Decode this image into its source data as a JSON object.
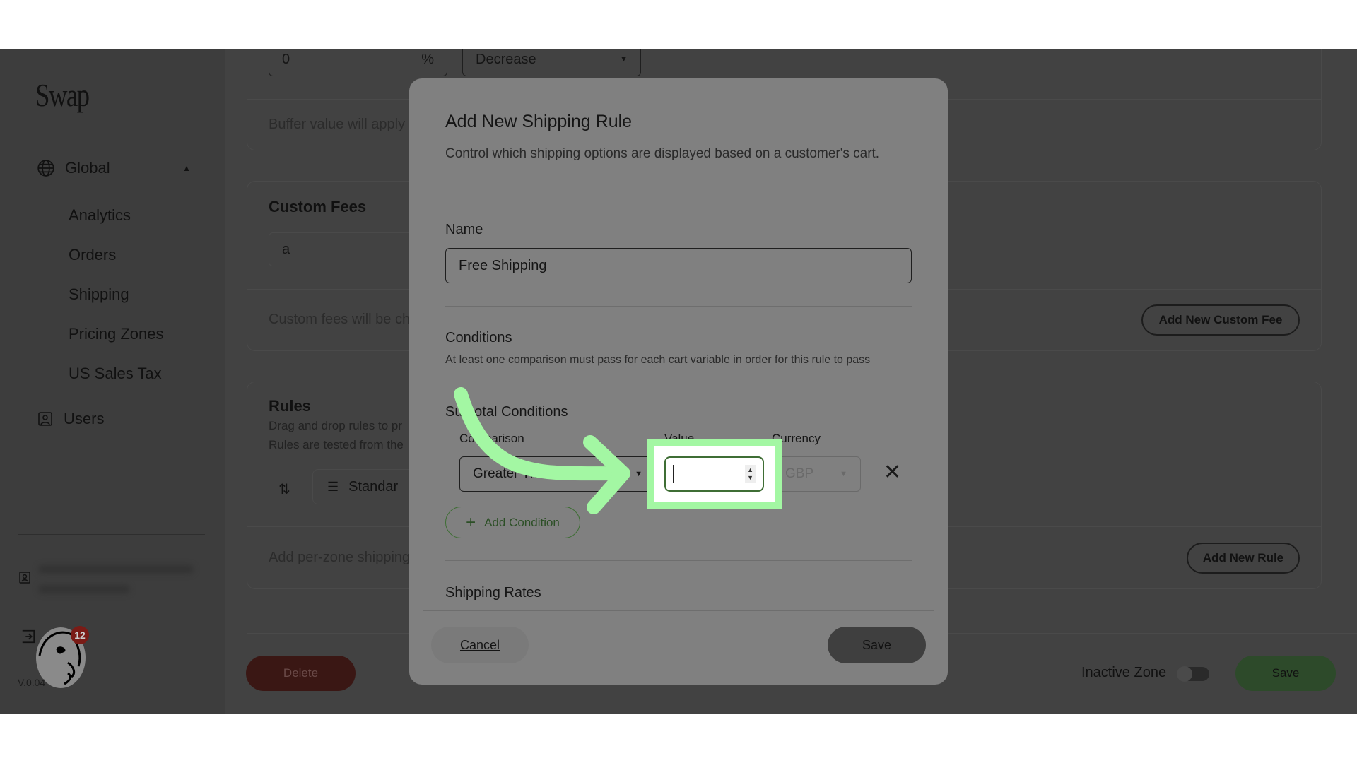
{
  "sidebar": {
    "logo": "Swap",
    "global": "Global",
    "items": [
      "Analytics",
      "Orders",
      "Shipping",
      "Pricing Zones",
      "US Sales Tax"
    ],
    "users": "Users",
    "badge": "12",
    "version": "V.0.04"
  },
  "main": {
    "buffer_value": "0",
    "buffer_unit": "%",
    "buffer_direction": "Decrease",
    "buffer_note": "Buffer value will apply",
    "custom_fees_title": "Custom Fees",
    "custom_fee_value": "a",
    "custom_fees_note": "Custom fees will be ch",
    "add_custom_fee": "Add New Custom Fee",
    "rules_title": "Rules",
    "rules_desc1": "Drag and drop rules to pr",
    "rules_desc2": "Rules are tested from the",
    "rule_item": "Standar",
    "rules_note": "Add per-zone shipping",
    "add_rule": "Add New Rule",
    "delete": "Delete",
    "inactive_zone": "Inactive Zone",
    "save": "Save"
  },
  "modal": {
    "title": "Add New Shipping Rule",
    "description": "Control which shipping options are displayed based on a customer's cart.",
    "name_label": "Name",
    "name_value": "Free Shipping",
    "conditions_title": "Conditions",
    "conditions_desc": "At least one comparison must pass for each cart variable in order for this rule to pass",
    "subtotal_title": "Subtotal Conditions",
    "col_comparison": "Comparison",
    "col_value": "Value",
    "col_currency": "Currency",
    "comparison_value": "Greater Than",
    "value_input": "",
    "currency_value": "GBP",
    "add_condition": "Add Condition",
    "shipping_rates": "Shipping Rates",
    "cancel": "Cancel",
    "save": "Save"
  },
  "colors": {
    "highlight": "#a3f7a3",
    "delete": "#3a1714",
    "save_green": "#2d4a2a",
    "accent_green": "#3f6e35"
  }
}
